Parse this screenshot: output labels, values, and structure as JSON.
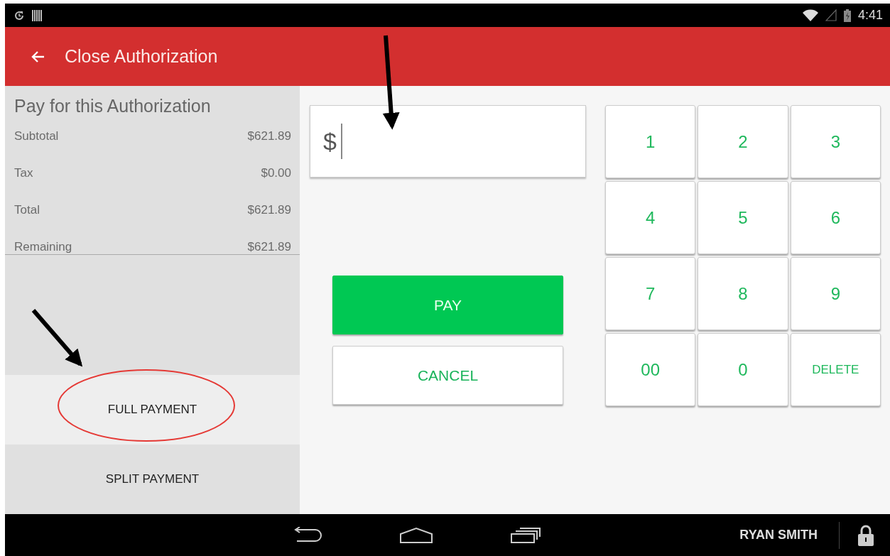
{
  "status_bar": {
    "time": "4:41"
  },
  "app_bar": {
    "title": "Close Authorization"
  },
  "summary": {
    "title": "Pay for this Authorization",
    "rows": [
      {
        "label": "Subtotal",
        "value": "$621.89"
      },
      {
        "label": "Tax",
        "value": "$0.00"
      },
      {
        "label": "Total",
        "value": "$621.89"
      },
      {
        "label": "Remaining",
        "value": "$621.89"
      }
    ]
  },
  "payment_options": [
    {
      "label": "FULL PAYMENT",
      "selected": true
    },
    {
      "label": "SPLIT PAYMENT",
      "selected": false
    }
  ],
  "amount_field": {
    "prefix": "$"
  },
  "actions": [
    {
      "label": "PAY",
      "kind": "primary"
    },
    {
      "label": "CANCEL",
      "kind": "secondary"
    }
  ],
  "keypad": [
    {
      "label": "1",
      "kind": "digit"
    },
    {
      "label": "2",
      "kind": "digit"
    },
    {
      "label": "3",
      "kind": "digit"
    },
    {
      "label": "4",
      "kind": "digit"
    },
    {
      "label": "5",
      "kind": "digit"
    },
    {
      "label": "6",
      "kind": "digit"
    },
    {
      "label": "7",
      "kind": "digit"
    },
    {
      "label": "8",
      "kind": "digit"
    },
    {
      "label": "9",
      "kind": "digit"
    },
    {
      "label": "00",
      "kind": "digit"
    },
    {
      "label": "0",
      "kind": "digit"
    },
    {
      "label": "DELETE",
      "kind": "command"
    }
  ],
  "nav_bar": {
    "user": "RYAN SMITH"
  }
}
